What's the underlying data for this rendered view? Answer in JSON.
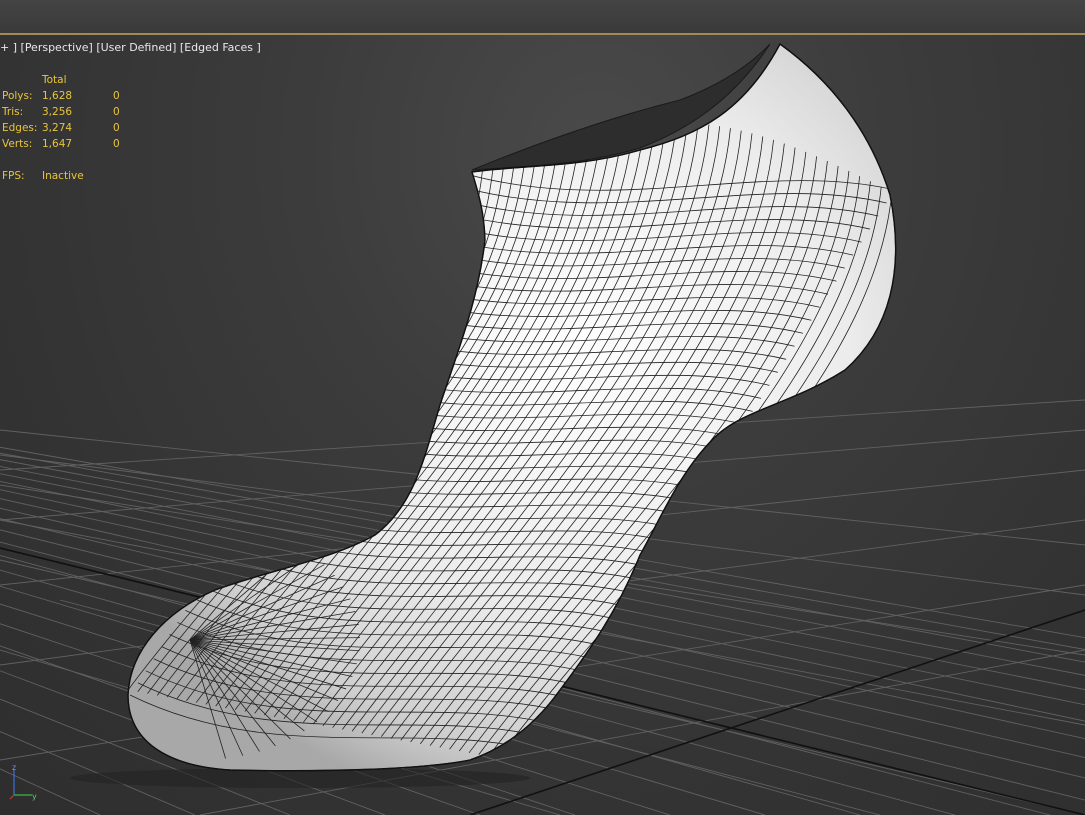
{
  "viewport": {
    "label_parts": [
      "+",
      "Perspective",
      "User Defined",
      "Edged Faces"
    ]
  },
  "stats": {
    "header": "Total",
    "rows": [
      {
        "label": "Polys:",
        "total": "1,628",
        "selected": "0"
      },
      {
        "label": "Tris:",
        "total": "3,256",
        "selected": "0"
      },
      {
        "label": "Edges:",
        "total": "3,274",
        "selected": "0"
      },
      {
        "label": "Verts:",
        "total": "1,647",
        "selected": "0"
      }
    ],
    "fps_label": "FPS:",
    "fps_value": "Inactive"
  },
  "gizmo": {
    "z": "z",
    "y": "y"
  },
  "colors": {
    "stats_text": "#e8c53a",
    "label_text": "#e8e8e8",
    "top_border": "#a08a55",
    "mesh_fill": "#f2f2f2",
    "grid_line": "#616161",
    "grid_axis": "#111111"
  }
}
